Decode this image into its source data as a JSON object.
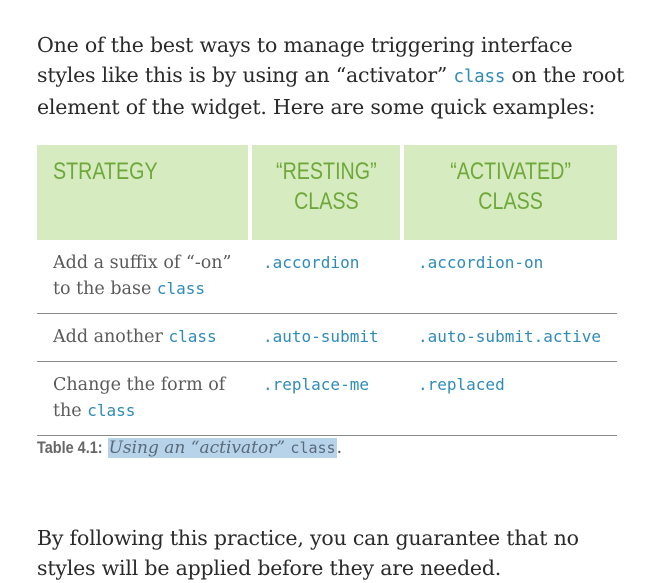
{
  "intro": {
    "before": "One of the best ways to manage triggering interface styles like this is by using an “activator” ",
    "code": "class",
    "after": " on the root element of the widget. Here are some quick examples:"
  },
  "table": {
    "headers": {
      "strategy": "STRATEGY",
      "resting_line1": "“RESTING”",
      "resting_line2": "CLASS",
      "activated_line1": "“ACTIVATED”",
      "activated_line2": "CLASS"
    },
    "rows": [
      {
        "strategy_text": "Add a suffix of “-on” to the base ",
        "strategy_code": "class",
        "strategy_after": "",
        "resting": ".accordion",
        "activated": ".accordion-on"
      },
      {
        "strategy_text": "Add another ",
        "strategy_code": "class",
        "strategy_after": "",
        "resting": ".auto-submit",
        "activated": ".auto-submit.active"
      },
      {
        "strategy_text": "Change the form of the ",
        "strategy_code": "class",
        "strategy_after": "",
        "resting": ".replace-me",
        "activated": ".replaced"
      }
    ]
  },
  "caption": {
    "label": "Table 4.1:",
    "text": "Using an “activator” ",
    "code": "class",
    "end": "."
  },
  "outro": {
    "text": "By following this practice, you can guarantee that no styles will be applied before they are needed."
  },
  "colors": {
    "header_bg": "#d6ebc0",
    "header_text": "#6ea83a",
    "code": "#2f8bb8",
    "highlight": "#b7d3ea"
  }
}
